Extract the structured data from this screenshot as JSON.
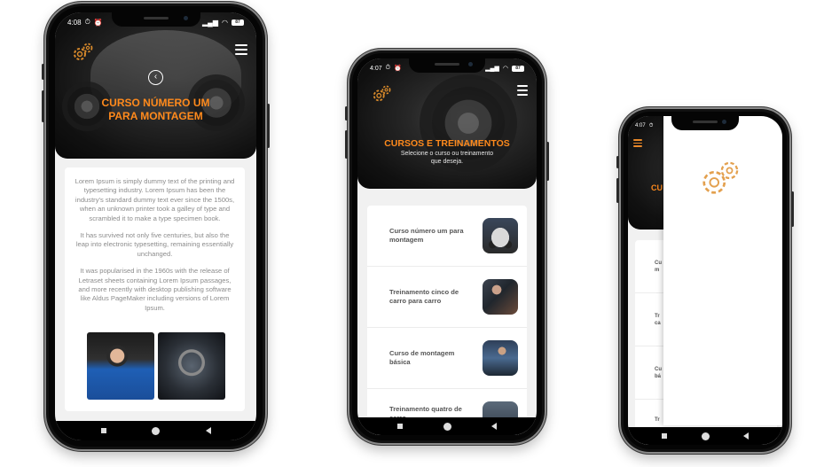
{
  "colors": {
    "accent": "#ff8a1c",
    "gear": "#d98a2b",
    "text": "#555555",
    "body_text": "#8c8c8c"
  },
  "phone1": {
    "status": {
      "time": "4:08",
      "battery": "87"
    },
    "hero_title": "CURSO NÚMERO UM PARA MONTAGEM",
    "paragraphs": [
      "Lorem Ipsum is simply dummy text of the printing and typesetting industry. Lorem Ipsum has been the industry's standard dummy text ever since the 1500s, when an unknown printer took a galley of type and scrambled it to make a type specimen book.",
      " It has survived not only five centuries, but also the leap into electronic typesetting, remaining essentially unchanged.",
      " It was popularised in the 1960s with the release of Letraset sheets containing Lorem Ipsum passages, and more recently with desktop publishing software like Aldus PageMaker including versions of Lorem Ipsum."
    ],
    "icons": [
      "gear-logo-icon",
      "menu-icon",
      "back-icon"
    ]
  },
  "phone2": {
    "status": {
      "time": "4:07",
      "battery": "87"
    },
    "hero_title": "CURSOS E TREINAMENTOS",
    "hero_subtitle": "Selecione o curso ou treinamento que deseja.",
    "items": [
      {
        "label": "Curso número um para montagem"
      },
      {
        "label": "Treinamento cinco de carro para carro"
      },
      {
        "label": "Curso de montagem básica"
      },
      {
        "label": "Treinamento quatro de carro"
      }
    ]
  },
  "phone3": {
    "status": {
      "time": "4:07"
    },
    "hero_title_partial": "CU",
    "list_partials": [
      "Cu",
      "m",
      "Tr",
      "ca",
      "Cu",
      "bá",
      "Tr"
    ]
  }
}
